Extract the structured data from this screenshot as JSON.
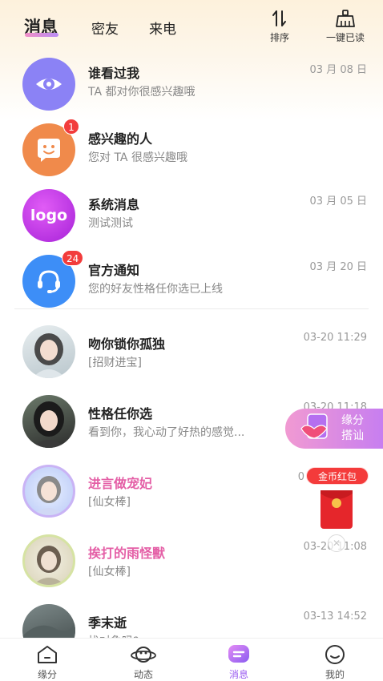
{
  "header": {
    "tabs": [
      {
        "label": "消息",
        "active": true
      },
      {
        "label": "密友",
        "active": false
      },
      {
        "label": "来电",
        "active": false
      }
    ],
    "actions": {
      "sort_label": "排序",
      "read_all_label": "一键已读"
    }
  },
  "system_items": [
    {
      "title": "谁看过我",
      "subtitle": "TA 都对你很感兴趣哦",
      "time": "03 月 08 日",
      "icon": "eye-icon",
      "color": "#8b82f5",
      "badge": ""
    },
    {
      "title": "感兴趣的人",
      "subtitle": "您对 TA 很感兴趣哦",
      "time": "",
      "icon": "smile-chat-icon",
      "color": "#f08a4b",
      "badge": "1"
    },
    {
      "title": "系统消息",
      "subtitle": "测试测试",
      "time": "03 月 05 日",
      "icon": "logo",
      "logo_text": "logo",
      "color": "#c23be8",
      "badge": ""
    },
    {
      "title": "官方通知",
      "subtitle": "您的好友性格任你选已上线",
      "time": "03 月 20 日",
      "icon": "headset-icon",
      "color": "#3d8ef7",
      "badge": "24"
    }
  ],
  "conversations": [
    {
      "name": "吻你锁你孤独",
      "preview": "[招财进宝]",
      "time": "03-20 11:29",
      "vip": false
    },
    {
      "name": "性格任你选",
      "preview": "看到你，我心动了好热的感觉...",
      "time": "03-20 11:18",
      "vip": false
    },
    {
      "name": "进言做宠妃",
      "preview": "[仙女棒]",
      "time": "0",
      "vip": true
    },
    {
      "name": "挨打的雨怪獸",
      "preview": "[仙女棒]",
      "time": "03-20 11:08",
      "vip": true
    },
    {
      "name": "季末逝",
      "preview": "找对象吗?",
      "time": "03-13 14:52",
      "vip": false
    }
  ],
  "floating": {
    "pill_line1": "缘分",
    "pill_line2": "搭讪",
    "coin_label": "金币红包"
  },
  "bottom_nav": [
    {
      "label": "缘分",
      "icon": "home-icon",
      "active": false
    },
    {
      "label": "动态",
      "icon": "planet-icon",
      "active": false
    },
    {
      "label": "消息",
      "icon": "message-icon",
      "active": true
    },
    {
      "label": "我的",
      "icon": "profile-icon",
      "active": false
    }
  ],
  "colors": {
    "accent": "#9b5cf0",
    "vip_name": "#e45fa6",
    "badge": "#f23c3c"
  }
}
